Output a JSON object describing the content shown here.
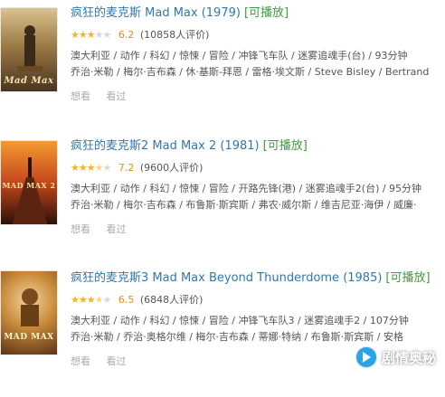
{
  "movies": [
    {
      "title": "疯狂的麦克斯 Mad Max (1979)",
      "playable": "[可播放]",
      "stars_filled": 3,
      "score": "6.2",
      "count": "(10858人评价)",
      "meta1": "澳大利亚 / 动作 / 科幻 / 惊悚 / 冒险 / 冲锋飞车队 / 迷雾追魂手(台) / 93分钟",
      "meta2": "乔治·米勒 / 梅尔·吉布森 / 休·基斯-拜恩 / 雷格·埃文斯 / Steve Bisley / Bertrand",
      "want": "想看",
      "seen": "看过",
      "poster_text": "Mad Max",
      "poster_colors": [
        "#c9b07a",
        "#7a5a2c",
        "#3a2a18"
      ]
    },
    {
      "title": "疯狂的麦克斯2 Mad Max 2 (1981)",
      "playable": "[可播放]",
      "stars_filled": 3.5,
      "score": "7.2",
      "count": "(9600人评价)",
      "meta1": "澳大利亚 / 动作 / 科幻 / 惊悚 / 冒险 / 开路先锋(港) / 迷雾追魂手2(台) / 95分钟",
      "meta2": "乔治·米勒 / 梅尔·吉布森 / 布鲁斯·斯宾斯 / 弗农·威尔斯 / 维吉尼亚·海伊 / 威廉·",
      "want": "想看",
      "seen": "看过",
      "poster_text": "MAD MAX 2",
      "poster_colors": [
        "#f08a24",
        "#b3361a",
        "#2a1208"
      ]
    },
    {
      "title": "疯狂的麦克斯3 Mad Max Beyond Thunderdome (1985)",
      "playable": "[可播放]",
      "stars_filled": 3.5,
      "score": "6.5",
      "count": "(6848人评价)",
      "meta1": "澳大利亚 / 动作 / 科幻 / 惊悚 / 冒险 / 冲锋飞车队3 / 迷雾追魂手2 / 107分钟",
      "meta2": "乔治·米勒 / 乔治·奥格尔维 / 梅尔·吉布森 / 蒂娜·特纳 / 布鲁斯·斯宾斯 / 安格",
      "want": "想看",
      "seen": "看过",
      "poster_text": "MAD MAX",
      "poster_colors": [
        "#e8c27a",
        "#b8742e",
        "#4a2c14"
      ]
    }
  ],
  "watermark": {
    "text": "剧情奥秘",
    "icon": "play-icon",
    "color": "#2aa4e8"
  }
}
